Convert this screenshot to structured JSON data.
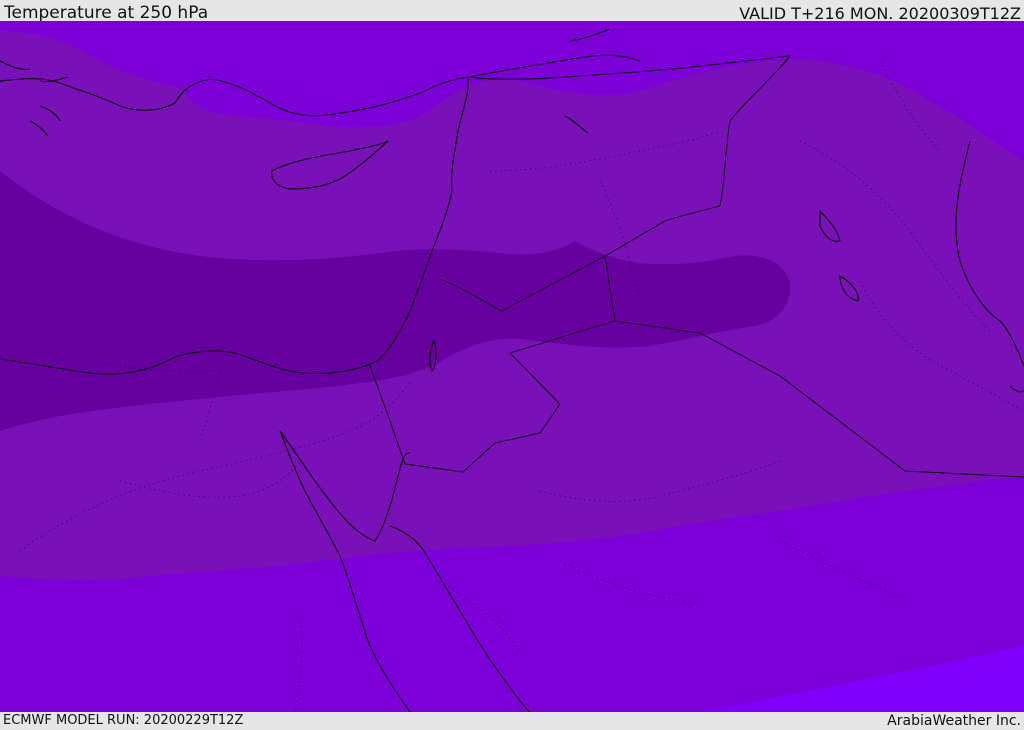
{
  "header": {
    "title": "Temperature at 250 hPa",
    "valid": "VALID T+216 MON. 20200309T12Z"
  },
  "footer": {
    "model_run": "ECMWF MODEL RUN: 20200229T12Z",
    "credit": "ArabiaWeather Inc."
  },
  "map": {
    "colors": {
      "band_warm_core": "#66009e",
      "band_mid": "#7a11b8",
      "band_cool": "#7d00d8",
      "band_coolest": "#7f00ff",
      "coastline": "#000000",
      "border": "#1a0030"
    }
  }
}
